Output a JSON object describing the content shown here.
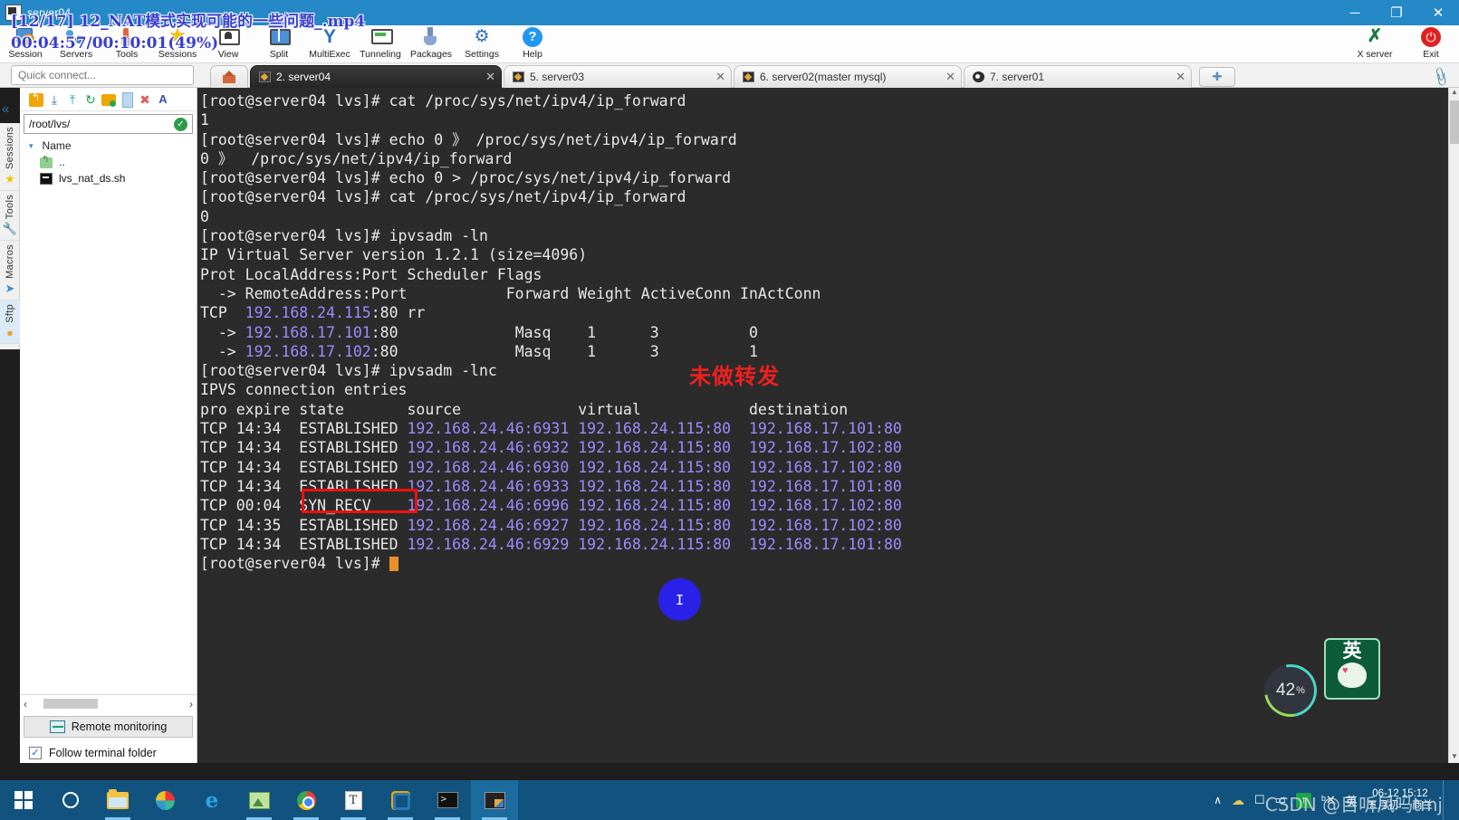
{
  "window": {
    "title": "server04",
    "minimize": "─",
    "maximize": "❐",
    "close": "✕"
  },
  "video_overlay": {
    "line1": "[12/17]  12_NAT模式实现可能的一些问题_.mp4",
    "line2": "00:04:57/00:10:01(49%)"
  },
  "toolbar": {
    "items": [
      {
        "label": "Session",
        "icon": "session-icon"
      },
      {
        "label": "Servers",
        "icon": "servers-icon"
      },
      {
        "label": "Tools",
        "icon": "tools-icon"
      },
      {
        "label": "Sessions",
        "icon": "star-icon"
      },
      {
        "label": "View",
        "icon": "view-icon"
      },
      {
        "label": "Split",
        "icon": "split-icon"
      },
      {
        "label": "MultiExec",
        "icon": "multiexec-icon"
      },
      {
        "label": "Tunneling",
        "icon": "tunneling-icon"
      },
      {
        "label": "Packages",
        "icon": "packages-icon"
      },
      {
        "label": "Settings",
        "icon": "settings-icon"
      },
      {
        "label": "Help",
        "icon": "help-icon"
      }
    ],
    "right_items": [
      {
        "label": "X server",
        "icon": "xserver-icon"
      },
      {
        "label": "Exit",
        "icon": "power-icon"
      }
    ]
  },
  "quick_connect": {
    "placeholder": "Quick connect..."
  },
  "tabs": {
    "home_icon": "home-icon",
    "items": [
      {
        "label": "2. server04",
        "active": true,
        "icon": "terminal-icon",
        "close": "✕"
      },
      {
        "label": "5. server03",
        "active": false,
        "icon": "terminal-icon",
        "close": "✕"
      },
      {
        "label": "6. server02(master mysql)",
        "active": false,
        "icon": "terminal-icon",
        "close": "✕"
      },
      {
        "label": "7. server01",
        "active": false,
        "icon": "ubuntu-icon",
        "close": "✕"
      }
    ],
    "add_label": "✚"
  },
  "rail": {
    "items": [
      {
        "label": "Sessions",
        "icon": "star-icon",
        "selected": false
      },
      {
        "label": "Tools",
        "icon": "wrench-icon",
        "selected": false
      },
      {
        "label": "Macros",
        "icon": "play-icon",
        "selected": false
      },
      {
        "label": "Sftp",
        "icon": "globe-icon",
        "selected": true
      }
    ],
    "collapse": "«"
  },
  "sftp": {
    "toolbar_icons": [
      "upload-parent-icon",
      "download-icon",
      "upload-icon",
      "refresh-icon",
      "new-folder-icon",
      "new-file-icon",
      "delete-icon",
      "rename-icon"
    ],
    "path": "/root/lvs/",
    "path_ok": "✓",
    "column_header": "Name",
    "caret": "▾",
    "rows": [
      {
        "name": "..",
        "icon": "parent-folder-icon"
      },
      {
        "name": "lvs_nat_ds.sh",
        "icon": "script-file-icon"
      }
    ],
    "scroll_left": "‹",
    "scroll_right": "›",
    "remote_monitoring": "Remote monitoring",
    "follow_terminal_folder": "Follow terminal folder",
    "follow_checked": "✓"
  },
  "terminal": {
    "prompt": "[root@server04 lvs]#",
    "lines": [
      {
        "segs": [
          {
            "t": "[root@server04 lvs]# cat /proc/sys/net/ipv4/ip_forward",
            "c": "w"
          }
        ]
      },
      {
        "segs": [
          {
            "t": "1",
            "c": "w"
          }
        ]
      },
      {
        "segs": [
          {
            "t": "[root@server04 lvs]# echo 0 》 /proc/sys/net/ipv4/ip_forward",
            "c": "w"
          }
        ]
      },
      {
        "segs": [
          {
            "t": "0 》  /proc/sys/net/ipv4/ip_forward",
            "c": "w"
          }
        ]
      },
      {
        "segs": [
          {
            "t": "[root@server04 lvs]# echo 0 > /proc/sys/net/ipv4/ip_forward",
            "c": "w"
          }
        ]
      },
      {
        "segs": [
          {
            "t": "[root@server04 lvs]# cat /proc/sys/net/ipv4/ip_forward",
            "c": "w"
          }
        ]
      },
      {
        "segs": [
          {
            "t": "0",
            "c": "w"
          }
        ]
      },
      {
        "segs": [
          {
            "t": "[root@server04 lvs]# ipvsadm -ln",
            "c": "w"
          }
        ]
      },
      {
        "segs": [
          {
            "t": "IP Virtual Server version 1.2.1 (size=4096)",
            "c": "w"
          }
        ]
      },
      {
        "segs": [
          {
            "t": "Prot LocalAddress:Port Scheduler Flags",
            "c": "w"
          }
        ]
      },
      {
        "segs": [
          {
            "t": "  -> RemoteAddress:Port           Forward Weight ActiveConn InActConn",
            "c": "w"
          }
        ]
      },
      {
        "segs": [
          {
            "t": "TCP  ",
            "c": "w"
          },
          {
            "t": "192.168.24.115",
            "c": "p"
          },
          {
            "t": ":80 rr",
            "c": "w"
          }
        ]
      },
      {
        "segs": [
          {
            "t": "  -> ",
            "c": "w"
          },
          {
            "t": "192.168.17.101",
            "c": "p"
          },
          {
            "t": ":80             Masq    1      3          0",
            "c": "w"
          }
        ]
      },
      {
        "segs": [
          {
            "t": "  -> ",
            "c": "w"
          },
          {
            "t": "192.168.17.102",
            "c": "p"
          },
          {
            "t": ":80             Masq    1      3          1",
            "c": "w"
          }
        ]
      },
      {
        "segs": [
          {
            "t": "[root@server04 lvs]# ipvsadm -lnc",
            "c": "w"
          }
        ]
      },
      {
        "segs": [
          {
            "t": "IPVS connection entries",
            "c": "w"
          }
        ]
      },
      {
        "segs": [
          {
            "t": "pro expire state       source             virtual            destination",
            "c": "w"
          }
        ]
      },
      {
        "segs": [
          {
            "t": "TCP 14:34  ESTABLISHED ",
            "c": "w"
          },
          {
            "t": "192.168.24.46:6931 192.168.24.115:80  192.168.17.101:80",
            "c": "p"
          }
        ]
      },
      {
        "segs": [
          {
            "t": "TCP 14:34  ESTABLISHED ",
            "c": "w"
          },
          {
            "t": "192.168.24.46:6932 192.168.24.115:80  192.168.17.102:80",
            "c": "p"
          }
        ]
      },
      {
        "segs": [
          {
            "t": "TCP 14:34  ESTABLISHED ",
            "c": "w"
          },
          {
            "t": "192.168.24.46:6930 192.168.24.115:80  192.168.17.102:80",
            "c": "p"
          }
        ]
      },
      {
        "segs": [
          {
            "t": "TCP 14:34  ESTABLISHED ",
            "c": "w"
          },
          {
            "t": "192.168.24.46:6933 192.168.24.115:80  192.168.17.101:80",
            "c": "p"
          }
        ]
      },
      {
        "segs": [
          {
            "t": "TCP 00:04  SYN_RECV    ",
            "c": "w"
          },
          {
            "t": "192.168.24.46:6996 192.168.24.115:80  192.168.17.102:80",
            "c": "p"
          }
        ]
      },
      {
        "segs": [
          {
            "t": "TCP 14:35  ESTABLISHED ",
            "c": "w"
          },
          {
            "t": "192.168.24.46:6927 192.168.24.115:80  192.168.17.102:80",
            "c": "p"
          }
        ]
      },
      {
        "segs": [
          {
            "t": "TCP 14:34  ESTABLISHED ",
            "c": "w"
          },
          {
            "t": "192.168.24.46:6929 192.168.24.115:80  192.168.17.101:80",
            "c": "p"
          }
        ]
      },
      {
        "segs": [
          {
            "t": "[root@server04 lvs]# ",
            "c": "w"
          },
          {
            "t": "",
            "c": "cursor"
          }
        ]
      }
    ]
  },
  "annotations": {
    "chinese_note": "未做转发",
    "note_color": "#ef2020",
    "arrow_color": "#f01010",
    "highlight_box_target": "SYN_RECV",
    "cursor_glyph": "I"
  },
  "widgets": {
    "volume_value": "42",
    "volume_unit": "%",
    "ime_mode": "英"
  },
  "taskbar": {
    "items": [
      {
        "icon": "windows-start-icon",
        "name": "start-button"
      },
      {
        "icon": "cortana-icon",
        "name": "cortana-button"
      },
      {
        "icon": "file-explorer-icon",
        "name": "file-explorer"
      },
      {
        "icon": "pinwheel-icon",
        "name": "pinwheel-app"
      },
      {
        "icon": "edge-icon",
        "name": "microsoft-edge"
      },
      {
        "icon": "picture-icon",
        "name": "photo-app"
      },
      {
        "icon": "chrome-icon",
        "name": "google-chrome"
      },
      {
        "icon": "typora-icon",
        "name": "typora"
      },
      {
        "icon": "vmware-icon",
        "name": "vmware"
      },
      {
        "icon": "cmd-icon",
        "name": "command-prompt"
      },
      {
        "icon": "mobaxterm-icon",
        "name": "mobaxterm"
      }
    ],
    "tray": {
      "expand": "∧",
      "cloud": "☁",
      "monitor": "☐",
      "battery": "▭",
      "green": "↑",
      "speaker": "ᵇ✕",
      "ime": "英"
    },
    "clock_time": "06-12 15:12",
    "clock_date": "五月初一 商兰"
  },
  "watermark": {
    "text": "CSDN @目听风吗tmj"
  }
}
